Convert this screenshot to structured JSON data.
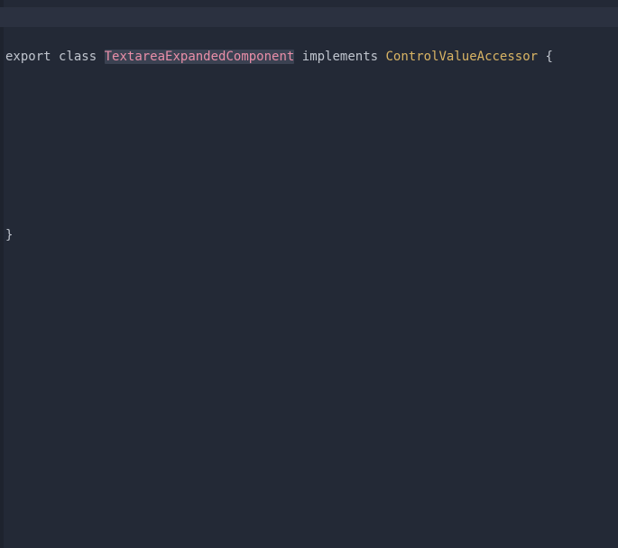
{
  "code": {
    "line1": {
      "kw_export": "export",
      "kw_class": "class",
      "class_name": "TextareaExpandedComponent",
      "kw_implements": "implements",
      "iface_name": "ControlValueAccessor",
      "brace_open": "{"
    },
    "line4": {
      "brace_close": "}"
    }
  }
}
